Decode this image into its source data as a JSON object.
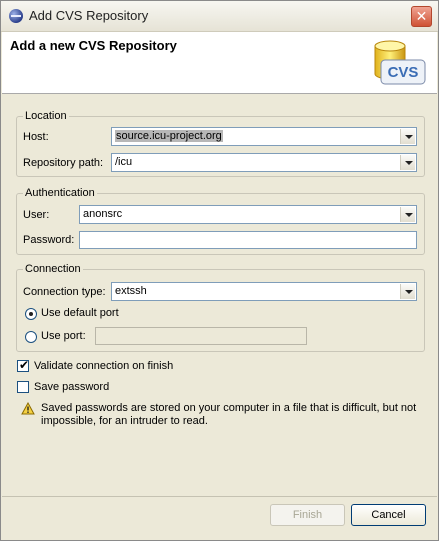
{
  "window": {
    "title": "Add CVS Repository"
  },
  "header": {
    "title": "Add a new CVS Repository",
    "logo_text": "CVS"
  },
  "location": {
    "legend": "Location",
    "host_label": "Host:",
    "host_value": "source.icu-project.org",
    "path_label": "Repository path:",
    "path_value": "/icu"
  },
  "authentication": {
    "legend": "Authentication",
    "user_label": "User:",
    "user_value": "anonsrc",
    "password_label": "Password:",
    "password_value": ""
  },
  "connection": {
    "legend": "Connection",
    "type_label": "Connection type:",
    "type_value": "extssh",
    "default_port_label": "Use default port",
    "use_port_label": "Use port:",
    "port_value": ""
  },
  "options": {
    "validate_label": "Validate connection on finish",
    "validate_checked": true,
    "save_password_label": "Save password",
    "save_password_checked": false,
    "warning_text": "Saved passwords are stored on your computer in a file that is difficult, but not impossible, for an intruder to read."
  },
  "buttons": {
    "finish": "Finish",
    "cancel": "Cancel"
  }
}
